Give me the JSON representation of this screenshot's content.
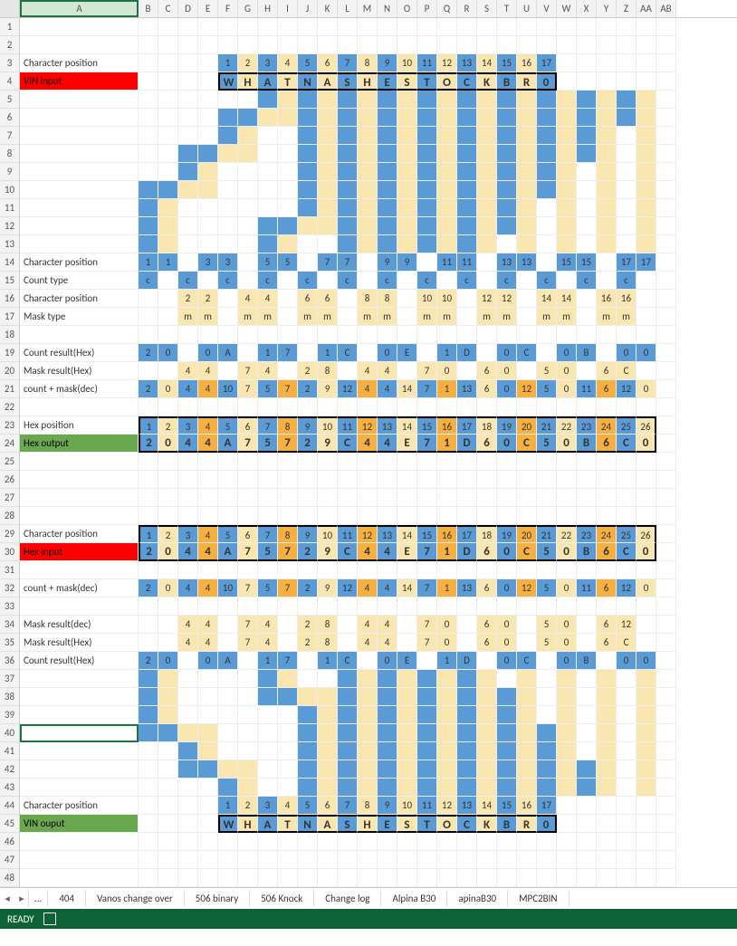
{
  "columns": [
    "A",
    "B",
    "C",
    "D",
    "E",
    "F",
    "G",
    "H",
    "I",
    "J",
    "K",
    "L",
    "M",
    "N",
    "O",
    "P",
    "Q",
    "R",
    "S",
    "T",
    "U",
    "V",
    "W",
    "X",
    "Y",
    "Z",
    "AA",
    "AB"
  ],
  "selected_cell": "A40",
  "labels": {
    "r3": "Character position",
    "r4": "VIN input",
    "r14": "Character position",
    "r15": "Count type",
    "r16": "Character position",
    "r17": "Mask type",
    "r19": "Count result(Hex)",
    "r20": "Mask result(Hex)",
    "r21": "count + mask(dec)",
    "r23": "Hex position",
    "r24": "Hex output",
    "r29": "Character position",
    "r30": "Hex input",
    "r32": "count + mask(dec)",
    "r34": "Mask result(dec)",
    "r35": "Mask result(Hex)",
    "r36": "Count result(Hex)",
    "r44": "Character position",
    "r45": "VIN ouput"
  },
  "row3": [
    "1",
    "2",
    "3",
    "4",
    "5",
    "6",
    "7",
    "8",
    "9",
    "10",
    "11",
    "12",
    "13",
    "14",
    "15",
    "16",
    "17"
  ],
  "row4": [
    "W",
    "H",
    "A",
    "T",
    "N",
    "A",
    "S",
    "H",
    "E",
    "S",
    "T",
    "O",
    "C",
    "K",
    "B",
    "R",
    "0"
  ],
  "row14": [
    "1",
    "1",
    "",
    "3",
    "3",
    "",
    "5",
    "5",
    "",
    "7",
    "7",
    "",
    "9",
    "9",
    "",
    "11",
    "11",
    "",
    "13",
    "13",
    "",
    "15",
    "15",
    "",
    "17",
    "17"
  ],
  "row15": [
    "c",
    "",
    "c",
    "",
    "c",
    "",
    "c",
    "",
    "c",
    "",
    "c",
    "",
    "c",
    "",
    "c",
    "",
    "c",
    "",
    "c",
    "",
    "c",
    "",
    "c",
    "",
    "c",
    ""
  ],
  "row16": [
    "",
    "",
    "2",
    "2",
    "",
    "4",
    "4",
    "",
    "6",
    "6",
    "",
    "8",
    "8",
    "",
    "10",
    "10",
    "",
    "12",
    "12",
    "",
    "14",
    "14",
    "",
    "16",
    "16",
    ""
  ],
  "row17": [
    "",
    "",
    "m",
    "m",
    "",
    "m",
    "m",
    "",
    "m",
    "m",
    "",
    "m",
    "m",
    "",
    "m",
    "m",
    "",
    "m",
    "m",
    "",
    "m",
    "m",
    "",
    "m",
    "m",
    ""
  ],
  "row19": [
    "2",
    "0",
    "",
    "0",
    "A",
    "",
    "1",
    "7",
    "",
    "1",
    "C",
    "",
    "0",
    "E",
    "",
    "1",
    "D",
    "",
    "0",
    "C",
    "",
    "0",
    "B",
    "",
    "0",
    "0"
  ],
  "row20": [
    "",
    "",
    "4",
    "4",
    "",
    "7",
    "4",
    "",
    "2",
    "8",
    "",
    "4",
    "4",
    "",
    "7",
    "0",
    "",
    "6",
    "0",
    "",
    "5",
    "0",
    "",
    "6",
    "C",
    ""
  ],
  "row21": [
    "2",
    "0",
    "4",
    "4",
    "10",
    "7",
    "5",
    "7",
    "2",
    "9",
    "12",
    "4",
    "4",
    "14",
    "7",
    "1",
    "13",
    "6",
    "0",
    "12",
    "5",
    "0",
    "11",
    "6",
    "12",
    "0"
  ],
  "row23": [
    "1",
    "2",
    "3",
    "4",
    "5",
    "6",
    "7",
    "8",
    "9",
    "10",
    "11",
    "12",
    "13",
    "14",
    "15",
    "16",
    "17",
    "18",
    "19",
    "20",
    "21",
    "22",
    "23",
    "24",
    "25",
    "26"
  ],
  "row24": [
    "2",
    "0",
    "4",
    "4",
    "A",
    "7",
    "5",
    "7",
    "2",
    "9",
    "C",
    "4",
    "4",
    "E",
    "7",
    "1",
    "D",
    "6",
    "0",
    "C",
    "5",
    "0",
    "B",
    "6",
    "C",
    "0"
  ],
  "row29": [
    "1",
    "2",
    "3",
    "4",
    "5",
    "6",
    "7",
    "8",
    "9",
    "10",
    "11",
    "12",
    "13",
    "14",
    "15",
    "16",
    "17",
    "18",
    "19",
    "20",
    "21",
    "22",
    "23",
    "24",
    "25",
    "26"
  ],
  "row30": [
    "2",
    "0",
    "4",
    "4",
    "A",
    "7",
    "5",
    "7",
    "2",
    "9",
    "C",
    "4",
    "4",
    "E",
    "7",
    "1",
    "D",
    "6",
    "0",
    "C",
    "5",
    "0",
    "B",
    "6",
    "C",
    "0"
  ],
  "row32": [
    "2",
    "0",
    "4",
    "4",
    "10",
    "7",
    "5",
    "7",
    "2",
    "9",
    "12",
    "4",
    "4",
    "14",
    "7",
    "1",
    "13",
    "6",
    "0",
    "12",
    "5",
    "0",
    "11",
    "6",
    "12",
    "0"
  ],
  "row34": [
    "",
    "",
    "4",
    "4",
    "",
    "7",
    "4",
    "",
    "2",
    "8",
    "",
    "4",
    "4",
    "",
    "7",
    "0",
    "",
    "6",
    "0",
    "",
    "5",
    "0",
    "",
    "6",
    "12",
    ""
  ],
  "row35": [
    "",
    "",
    "4",
    "4",
    "",
    "7",
    "4",
    "",
    "2",
    "8",
    "",
    "4",
    "4",
    "",
    "7",
    "0",
    "",
    "6",
    "0",
    "",
    "5",
    "0",
    "",
    "6",
    "C",
    ""
  ],
  "row36": [
    "2",
    "0",
    "",
    "0",
    "A",
    "",
    "1",
    "7",
    "",
    "1",
    "C",
    "",
    "0",
    "E",
    "",
    "1",
    "D",
    "",
    "0",
    "C",
    "",
    "0",
    "B",
    "",
    "0",
    "0"
  ],
  "row44": [
    "1",
    "2",
    "3",
    "4",
    "5",
    "6",
    "7",
    "8",
    "9",
    "10",
    "11",
    "12",
    "13",
    "14",
    "15",
    "16",
    "17"
  ],
  "row45": [
    "W",
    "H",
    "A",
    "T",
    "N",
    "A",
    "S",
    "H",
    "E",
    "S",
    "T",
    "O",
    "C",
    "K",
    "B",
    "R",
    "0"
  ],
  "tabs": [
    "...",
    "404",
    "Vanos change over",
    "506 binary",
    "506 Knock",
    "Change log",
    "Alpina B30",
    "apinaB30",
    "MPC2BIN"
  ],
  "status": "READY",
  "colors": {
    "blue": "#5b9bd5",
    "yellow": "#f9e6b1",
    "orange": "#f5b041",
    "red": "#ff0000",
    "green": "#6aa84f"
  },
  "chart_data": null
}
